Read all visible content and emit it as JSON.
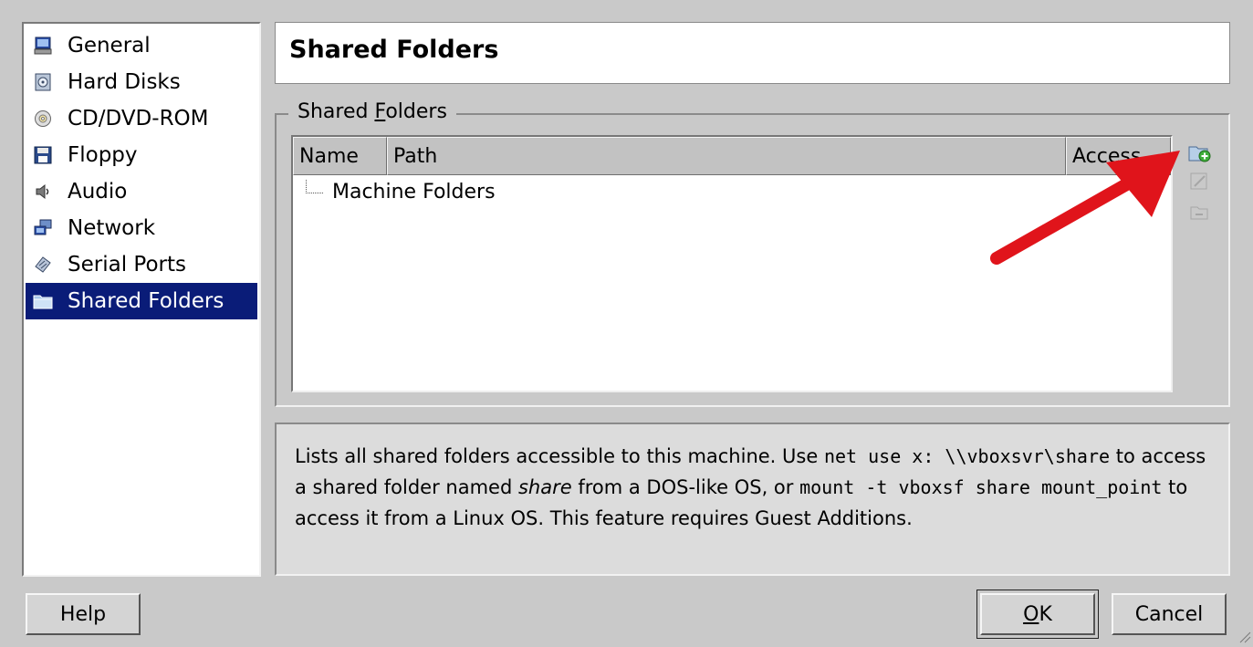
{
  "sidebar": {
    "items": [
      {
        "label": "General",
        "icon": "monitor-icon",
        "selected": false
      },
      {
        "label": "Hard Disks",
        "icon": "hard-disk-icon",
        "selected": false
      },
      {
        "label": "CD/DVD-ROM",
        "icon": "cd-icon",
        "selected": false
      },
      {
        "label": "Floppy",
        "icon": "floppy-icon",
        "selected": false
      },
      {
        "label": "Audio",
        "icon": "audio-icon",
        "selected": false
      },
      {
        "label": "Network",
        "icon": "network-icon",
        "selected": false
      },
      {
        "label": "Serial Ports",
        "icon": "serial-port-icon",
        "selected": false
      },
      {
        "label": "Shared Folders",
        "icon": "shared-folder-icon",
        "selected": true
      }
    ],
    "selected_bg": "#0a1c78"
  },
  "main": {
    "title": "Shared Folders",
    "group": {
      "legend_prefix": "Shared ",
      "legend_accel": "F",
      "legend_suffix": "olders"
    },
    "table": {
      "columns": [
        "Name",
        "Path",
        "Access"
      ],
      "rows": [
        {
          "label": "Machine Folders"
        }
      ]
    },
    "tools": [
      {
        "name": "add-shared-folder-icon",
        "enabled": true
      },
      {
        "name": "edit-shared-folder-icon",
        "enabled": false
      },
      {
        "name": "remove-shared-folder-icon",
        "enabled": false
      }
    ],
    "info": {
      "t1": "Lists all shared folders accessible to this machine. Use ",
      "c1": "net use x: \\\\vboxsvr\\share",
      "t2": " to access a shared folder named ",
      "em": "share",
      "t3": " from a DOS-like OS, or ",
      "c2": "mount -t vboxsf share mount_point",
      "t4": " to access it from a Linux OS. This feature requires Guest Additions."
    }
  },
  "buttons": {
    "help": "Help",
    "ok_accel": "O",
    "ok_rest": "K",
    "cancel": "Cancel"
  },
  "annotation": {
    "arrow_color": "#e0141b"
  }
}
